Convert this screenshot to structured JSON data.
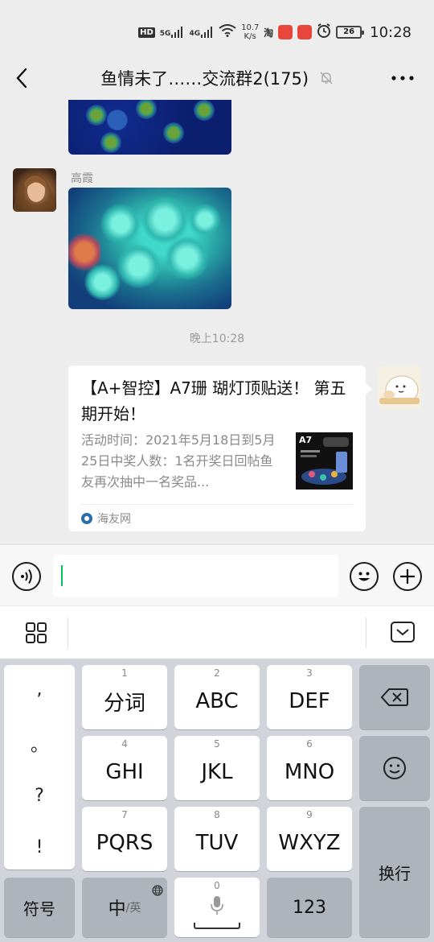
{
  "status_bar": {
    "hd_label": "HD",
    "net_5g": "5G",
    "net_4g": "4G",
    "speed_value": "10.7",
    "speed_unit": "K/s",
    "battery": "26",
    "time": "10:28"
  },
  "header": {
    "title": "鱼情未了……交流群2(175)"
  },
  "chat": {
    "sender_name": "高霞",
    "timestamp": "晚上10:28",
    "link_card": {
      "title": "【A+智控】A7珊 瑚灯顶贴送！ 第五期开始！",
      "description": "活动时间：2021年5月18日到5月25日中奖人数：1名开奖日回帖鱼友再次抽中一名奖品...",
      "thumb_label": "A7",
      "source": "海友网"
    }
  },
  "keyboard": {
    "punct": [
      ",",
      "。",
      "?",
      "!"
    ],
    "keys": [
      {
        "num": "1",
        "label": "分词"
      },
      {
        "num": "2",
        "label": "ABC"
      },
      {
        "num": "3",
        "label": "DEF"
      },
      {
        "num": "4",
        "label": "GHI"
      },
      {
        "num": "5",
        "label": "JKL"
      },
      {
        "num": "6",
        "label": "MNO"
      },
      {
        "num": "7",
        "label": "PQRS"
      },
      {
        "num": "8",
        "label": "TUV"
      },
      {
        "num": "9",
        "label": "WXYZ"
      }
    ],
    "symbols_label": "符号",
    "lang_main": "中",
    "lang_sub": "/英",
    "space_num": "0",
    "num_label": "123",
    "enter_label": "换行"
  },
  "colors": {
    "accent": "#07c160",
    "background": "#ededed",
    "keyboard_bg": "#d1d5db"
  }
}
